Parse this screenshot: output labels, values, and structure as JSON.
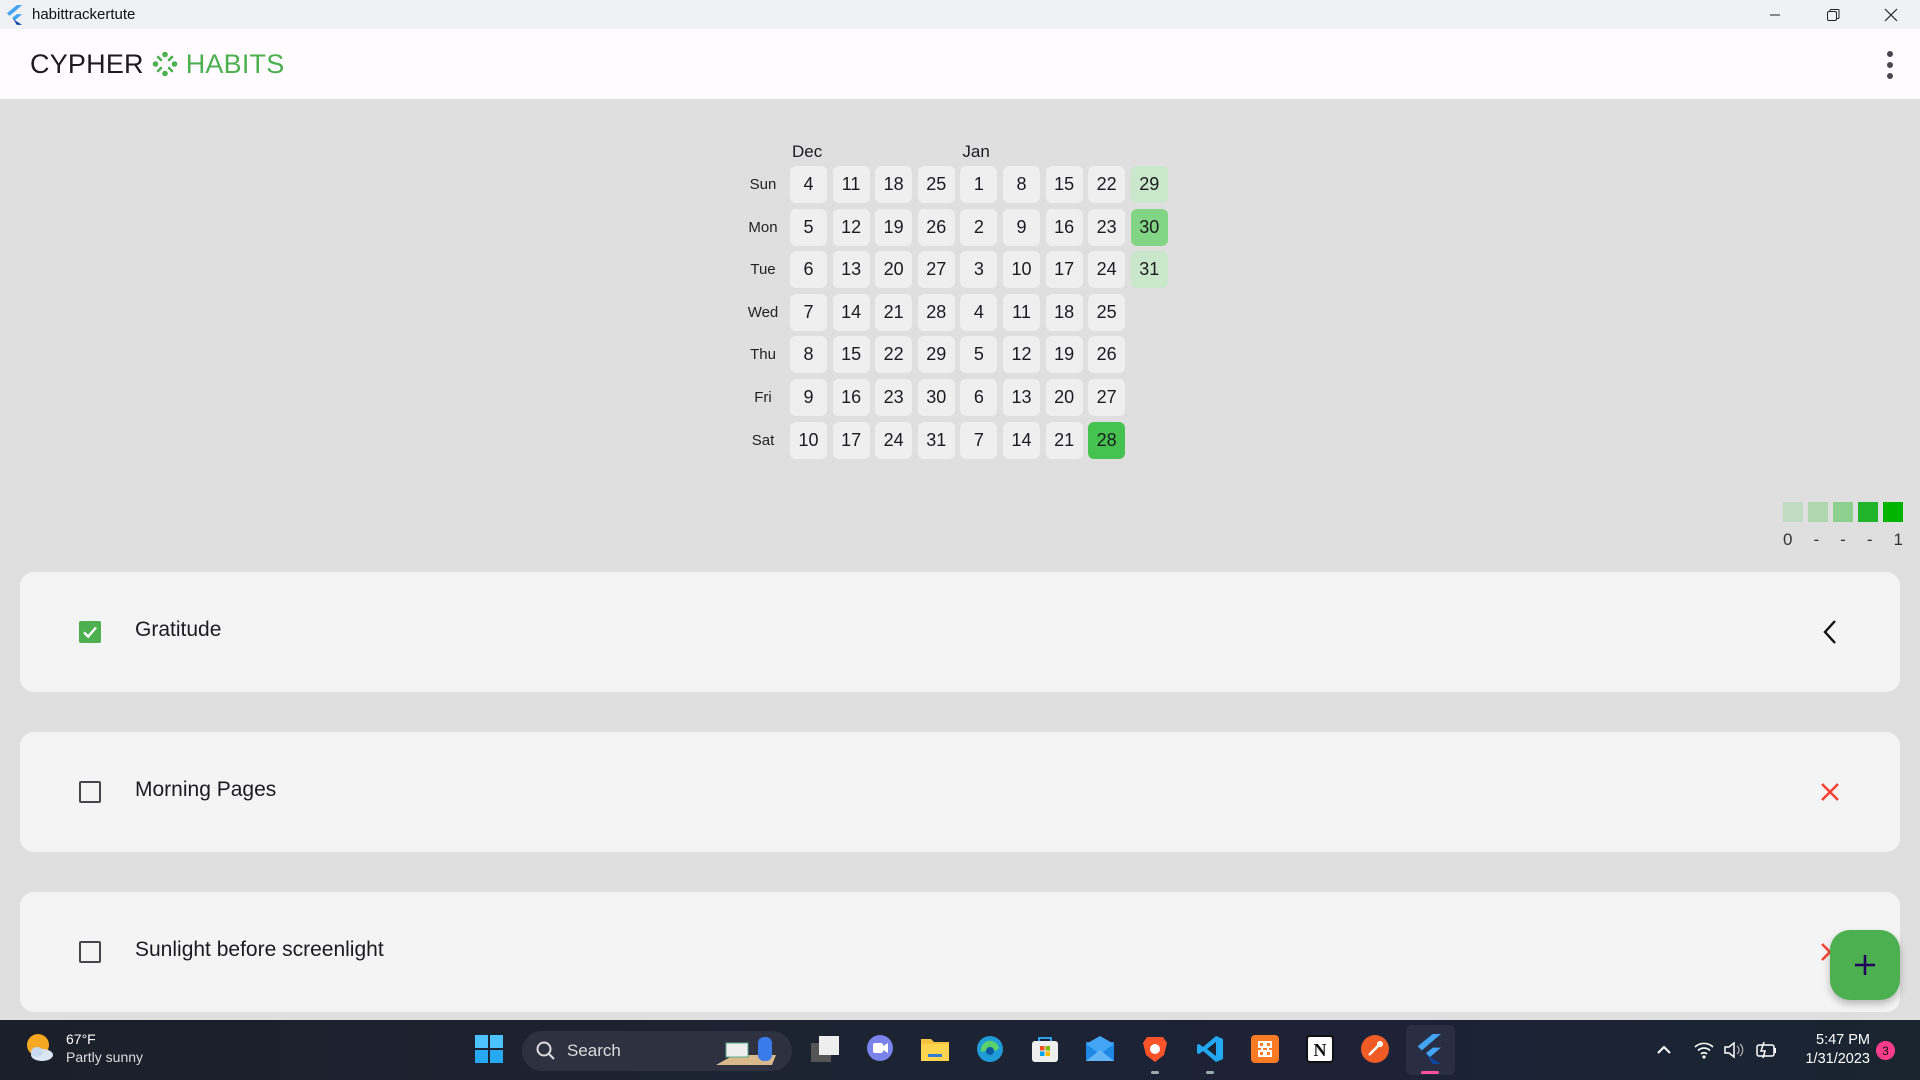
{
  "window": {
    "title": "habittrackertute",
    "controls": [
      "minimize",
      "restore",
      "close"
    ]
  },
  "appbar": {
    "brand_left": "CYPHER",
    "brand_right": "HABITS",
    "menu_icon": "more-vert-icon"
  },
  "heatmap": {
    "months": [
      {
        "label": "Dec",
        "column": 0
      },
      {
        "label": "Jan",
        "column": 4
      }
    ],
    "day_labels": [
      "Sun",
      "Mon",
      "Tue",
      "Wed",
      "Thu",
      "Fri",
      "Sat"
    ],
    "weeks": [
      [
        4,
        5,
        6,
        7,
        8,
        9,
        10
      ],
      [
        11,
        12,
        13,
        14,
        15,
        16,
        17
      ],
      [
        18,
        19,
        20,
        21,
        22,
        23,
        24
      ],
      [
        25,
        26,
        27,
        28,
        29,
        30,
        31
      ],
      [
        1,
        2,
        3,
        4,
        5,
        6,
        7
      ],
      [
        8,
        9,
        10,
        11,
        12,
        13,
        14
      ],
      [
        15,
        16,
        17,
        18,
        19,
        20,
        21
      ],
      [
        22,
        23,
        24,
        25,
        26,
        27,
        28
      ],
      [
        29,
        30,
        31
      ]
    ],
    "completion": {
      "7-6": 1.0,
      "8-0": 0.3,
      "8-1": 0.6,
      "8-2": 0.3
    },
    "colors": {
      "empty": "#efefef",
      "level_0.3": "#c9e7ca",
      "level_0.6": "#81d584",
      "level_1.0": "#46c250"
    }
  },
  "legend": {
    "swatches": [
      "#c1dcc3",
      "#aed7b0",
      "#8dcf8f",
      "#20b62b",
      "#00b400"
    ],
    "labels": [
      "0",
      "-",
      "-",
      "-",
      "1"
    ]
  },
  "habits": [
    {
      "name": "Gratitude",
      "completed": true,
      "action_icon": "chevron-left-icon"
    },
    {
      "name": "Morning Pages",
      "completed": false,
      "action_icon": "close-icon"
    },
    {
      "name": "Sunlight before screenlight",
      "completed": false,
      "action_icon": "close-icon"
    }
  ],
  "fab": {
    "icon": "add-icon",
    "color": "#4caf50"
  },
  "taskbar": {
    "weather": {
      "temp": "67°F",
      "condition": "Partly sunny"
    },
    "search_placeholder": "Search",
    "apps": [
      "Task View",
      "Teams Chat",
      "File Explorer",
      "Microsoft Edge",
      "Microsoft Store",
      "Mail",
      "Brave",
      "Visual Studio Code",
      "XAMPP",
      "Notion",
      "Postman",
      "Flutter App"
    ],
    "clock": {
      "time": "5:47 PM",
      "date": "1/31/2023"
    },
    "notification_count": "3"
  }
}
